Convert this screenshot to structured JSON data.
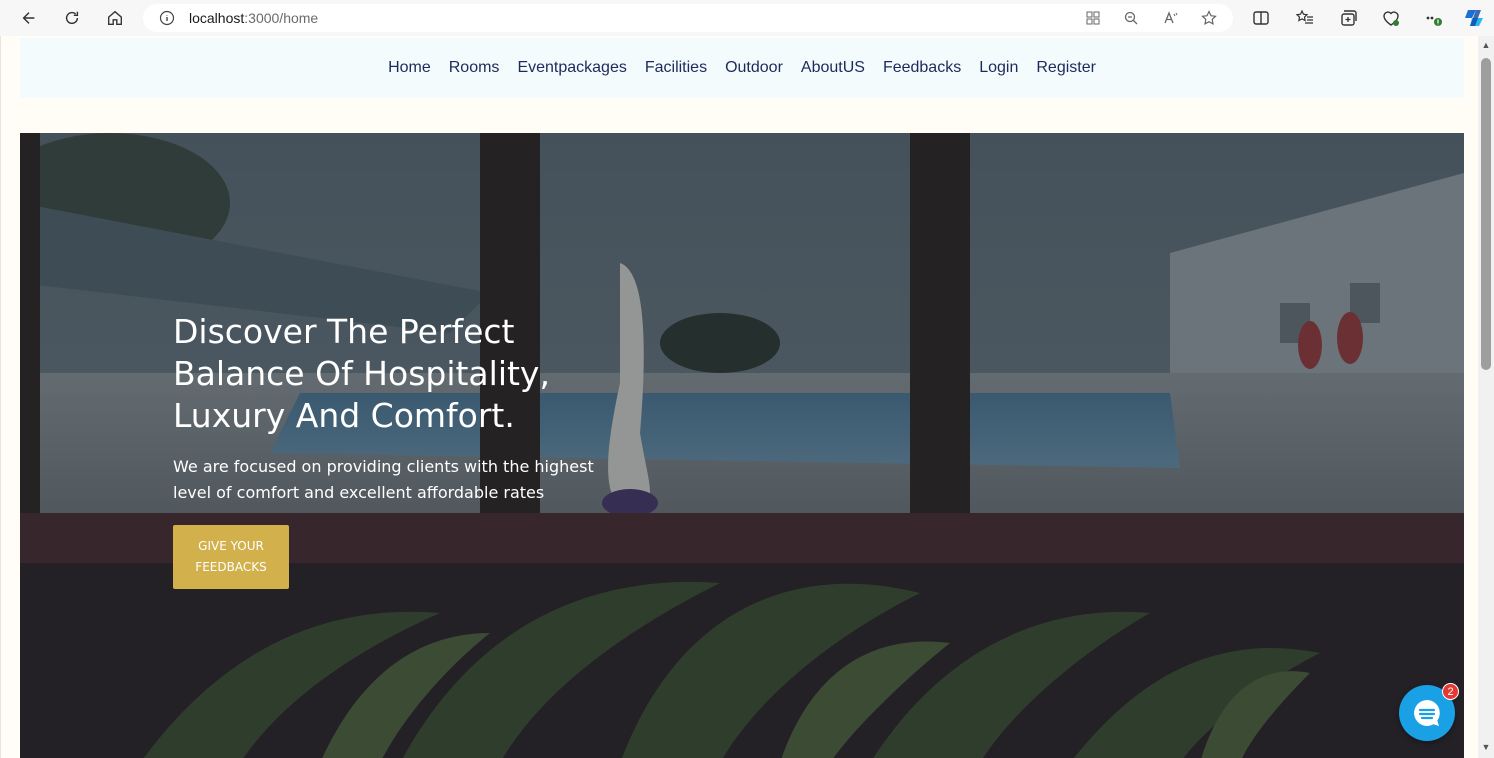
{
  "browser": {
    "url_host": "localhost",
    "url_path": ":3000/home"
  },
  "nav": {
    "items": [
      "Home",
      "Rooms",
      "Eventpackages",
      "Facilities",
      "Outdoor",
      "AboutUS",
      "Feedbacks",
      "Login",
      "Register"
    ]
  },
  "hero": {
    "title": "Discover The Perfect Balance Of Hospitality, Luxury And Comfort.",
    "subtitle": "We are focused on providing clients with the highest level of comfort and excellent affordable rates",
    "button_label": "GIVE YOUR FEEDBACKS"
  },
  "chat": {
    "badge_count": "2"
  },
  "colors": {
    "nav_bg": "#f4fbfd",
    "nav_text": "#1c2a5c",
    "button_bg": "#d2b04c",
    "chat_bg": "#1aa0e4",
    "badge_bg": "#e53935"
  }
}
